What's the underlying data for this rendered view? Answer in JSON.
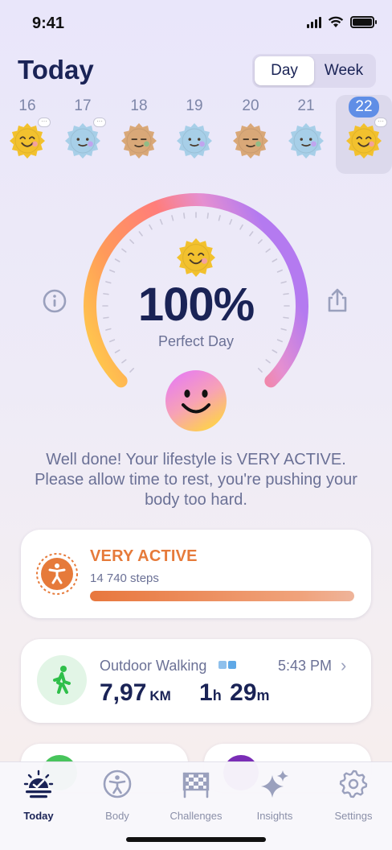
{
  "status_bar": {
    "time": "9:41"
  },
  "header": {
    "title": "Today",
    "segments": [
      "Day",
      "Week"
    ],
    "active_segment": "Day"
  },
  "week": [
    {
      "day": "16",
      "face": "happy",
      "color": "#f2c12e",
      "has_note": true
    },
    {
      "day": "17",
      "face": "neutral",
      "color": "#a7cfe8",
      "has_note": true
    },
    {
      "day": "18",
      "face": "sleepy",
      "color": "#d9a878",
      "has_note": false
    },
    {
      "day": "19",
      "face": "neutral",
      "color": "#a7cfe8",
      "has_note": false
    },
    {
      "day": "20",
      "face": "sleepy",
      "color": "#d9a878",
      "has_note": false
    },
    {
      "day": "21",
      "face": "neutral",
      "color": "#a7cfe8",
      "has_note": false
    },
    {
      "day": "22",
      "face": "happy",
      "color": "#f2c12e",
      "has_note": true,
      "selected": true
    }
  ],
  "gauge": {
    "value": "100%",
    "label": "Perfect Day",
    "progress": 1.0
  },
  "message": "Well done! Your lifestyle is VERY ACTIVE. Please allow time to rest, you're pushing your body too hard.",
  "activity_card": {
    "title": "VERY ACTIVE",
    "steps": "14 740 steps",
    "progress": 1.0,
    "accent": "#e67a3a"
  },
  "workout_card": {
    "title": "Outdoor Walking",
    "time": "5:43 PM",
    "distance_value": "7,97",
    "distance_unit": "KM",
    "duration_hours": "1",
    "duration_hours_unit": "h",
    "duration_minutes": "29",
    "duration_minutes_unit": "m"
  },
  "tabs": [
    {
      "label": "Today",
      "icon": "sunrise-check-icon",
      "active": true
    },
    {
      "label": "Body",
      "icon": "body-icon",
      "active": false
    },
    {
      "label": "Challenges",
      "icon": "checkered-flag-icon",
      "active": false
    },
    {
      "label": "Insights",
      "icon": "sparkles-icon",
      "active": false
    },
    {
      "label": "Settings",
      "icon": "gear-icon",
      "active": false
    }
  ]
}
